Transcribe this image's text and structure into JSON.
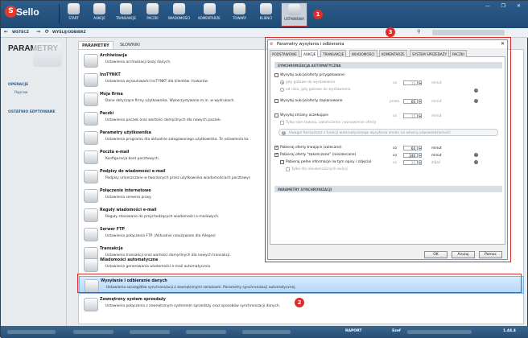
{
  "app": {
    "logo_text": "Sello",
    "logo_badge": "S"
  },
  "toolbar": {
    "buttons": [
      {
        "label": "START",
        "icon": "home-icon"
      },
      {
        "label": "AUKCJE",
        "icon": "gavel-icon"
      },
      {
        "label": "TRANSAKCJE",
        "icon": "coins-icon"
      },
      {
        "label": "PACZKI",
        "icon": "package-icon"
      },
      {
        "label": "WIADOMOŚCI",
        "icon": "envelope-icon"
      },
      {
        "label": "KOMENTARZE",
        "icon": "comments-icon"
      },
      {
        "label": "TOWARY",
        "icon": "truck-icon"
      },
      {
        "label": "KLIENCI",
        "icon": "users-icon"
      },
      {
        "label": "USTAWIENIA",
        "icon": "settings-icon"
      }
    ],
    "callout1": "1"
  },
  "nav": {
    "back": "WSTECZ",
    "send_receive": "WYŚLIJ/ODBIERZ"
  },
  "callouts": {
    "c2": "2",
    "c3": "3"
  },
  "left": {
    "title": "PARAMETRY",
    "section1": "OPERACJE",
    "link1": "Popraw",
    "section2": "OSTATNIO EDYTOWANE"
  },
  "tabs": {
    "t1": "PARAMETRY",
    "t2": "SŁOWNIKI"
  },
  "items": [
    {
      "title": "Archiwizacja",
      "desc": "Ustawienia archiwizacji bazy danych."
    },
    {
      "title": "InsTYNKT",
      "desc": "Ustawienia wyszukiwarki InsTYNKT dla klientów i towarów."
    },
    {
      "title": "Moja firma",
      "desc": "Dane dotyczące firmy użytkownika. Wykorzystywane m.in. w wydrukach."
    },
    {
      "title": "Paczki",
      "desc": "Ustawienia paczek oraz wartości domyślnych dla nowych paczek."
    },
    {
      "title": "Parametry użytkownika",
      "desc": "Ustawienia programu dla aktualnie zalogowanego użytkownika. Te ustawienia ka"
    },
    {
      "title": "Poczta e-mail",
      "desc": "Konfiguracja kont pocztowych."
    },
    {
      "title": "Podpisy do wiadomości e-mail",
      "desc": "Podpisy umieszczane w tworzonych przez użytkownika wiadomościach pocztowyc"
    },
    {
      "title": "Połączenie internetowe",
      "desc": "Ustawienia serwera proxy."
    },
    {
      "title": "Reguły wiadomości e-mail",
      "desc": "Reguły stosowane do przychodzących wiadomości e-mailowych."
    },
    {
      "title": "Serwer FTP",
      "desc": "Ustawienia połączenia FTP. (Aktualnie nieużywane dla Allegro)"
    },
    {
      "title": "Transakcje",
      "desc": "Ustawienia transakcji oraz wartości domyślnych dla nowych transakcji."
    },
    {
      "title": "Wiadomości automatyczne",
      "desc": "Ustawienia generowania wiadomości e-mail automatycznie."
    },
    {
      "title": "Wysyłanie i odbieranie danych",
      "desc": "Ustawienia szczegółów synchronizacji z zewnętrznymi serwisami. Parametry synchronizacji automatycznej."
    },
    {
      "title": "Zewnętrzny system sprzedaży",
      "desc": "Ustawienia połączenia z zewnętrznym systemem sprzedaży oraz sposobów synchronizacji danych."
    }
  ],
  "status": {
    "raport": "RAPORT",
    "szef": "Szef",
    "version": "1.44.4"
  },
  "dialog": {
    "title": "Parametry wysyłania i odbierania",
    "close": "✕",
    "tabs": [
      "PODSTAWOWE",
      "AUKCJE",
      "TRANSAKCJE",
      "WIADOMOŚCI",
      "KOMENTARZE",
      "SYSTEM SPRZEDAŻY",
      "PACZKI"
    ],
    "group1": "SYNCHRONIZACJA AUTOMATYCZNA",
    "group2": "PARAMETRY SYNCHRONIZACJI",
    "r1": "Wysyłaj aukcje/oferty przygotowane:",
    "r1a": "gdy gotowe do wystawienia",
    "r1b": "od razu, gdy gotowe do wystawienia",
    "r2": "Wysyłaj aukcje/oferty zaplanowane",
    "r3": "Wysyłaj zmiany oczekujące",
    "r3a": "Tylko stan towaru, zakończenie i wznowienie oferty",
    "note": "Uwaga! Korzystasz z funkcji automatycznego wysyłania zmian na własną odpowiedzialność",
    "r4": "Pobieraj oferty trwające (zalecane)",
    "r5": "Pobieraj oferty \"zakończone\" (niezalecane)",
    "r6": "Pobieraj pełne informacje (w tym opisy i zdjęcia)",
    "r7": "Tylko dla nieukończonych aukcji",
    "co": "co",
    "przez": "przez",
    "minut": "minut",
    "zdjec": "zdjęć",
    "v1": "15",
    "v2": "60",
    "v3": "15",
    "v4": "60",
    "v5": "240",
    "v6": "20",
    "ok": "OK",
    "cancel": "Anuluj",
    "help": "Pomoc"
  },
  "colors": {
    "accent": "#2d5d8c",
    "highlight": "#d9302b",
    "selection": "#b3d7fb"
  }
}
